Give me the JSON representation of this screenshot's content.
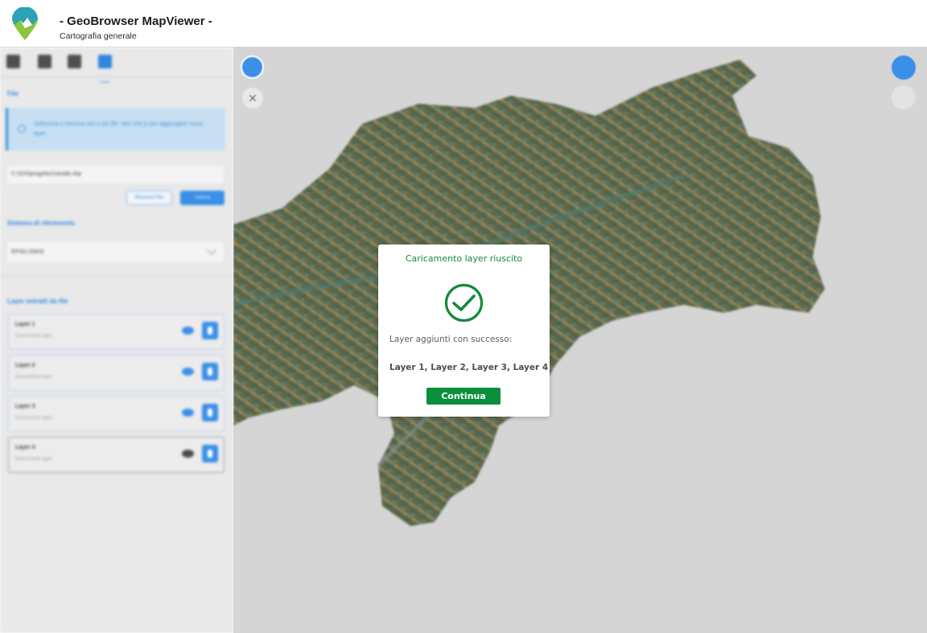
{
  "header": {
    "title": "- GeoBrowser MapViewer -",
    "subtitle": "Cartografia generale"
  },
  "sidebar": {
    "tabs": [
      "tab-1",
      "tab-2",
      "tab-3",
      "tab-upload"
    ],
    "file_section_label": "File",
    "info_text": "Seleziona o trascina uno o più file. Non ché ju per aggiungere nuovi layer.",
    "file_path": "C:\\GIS\\progetto1\\strade.shp",
    "remove_button": "Rimuovi File",
    "upload_button": "Carica",
    "crs_label": "Sistema di riferimento",
    "crs_value": "EPSG:25832",
    "layers_label": "Layer estratti da file",
    "layers": [
      {
        "name": "Layer 1",
        "description": "Descrizione layer",
        "visible": true
      },
      {
        "name": "Layer 2",
        "description": "Descrizione layer",
        "visible": true
      },
      {
        "name": "Layer 3",
        "description": "Descrizione layer",
        "visible": true
      },
      {
        "name": "Layer 4",
        "description": "Descrizione layer",
        "visible": false
      }
    ]
  },
  "map": {
    "close_glyph": "✕"
  },
  "modal": {
    "title": "Caricamento layer riuscito",
    "message": "Layer aggiunti con successo:",
    "layers_list": "Layer 1, Layer 2, Layer 3, Layer 4",
    "button": "Continua"
  },
  "colors": {
    "accent": "#2e86de",
    "success": "#0a8f3d"
  }
}
